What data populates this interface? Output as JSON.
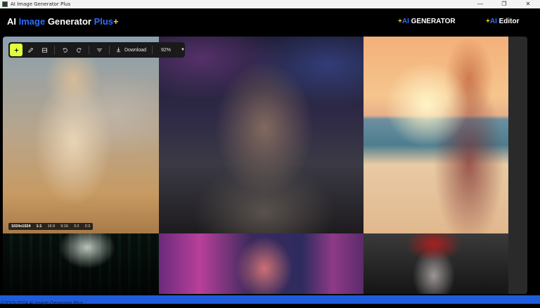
{
  "window": {
    "title": "AI Image Generator Plus",
    "controls": [
      "—",
      "❐",
      "✕"
    ]
  },
  "header": {
    "brand": {
      "part1": "AI ",
      "part2": "Image",
      "part3": " Generator ",
      "part4": "Plus",
      "star": "+"
    },
    "nav": [
      {
        "star": "+",
        "ai": "AI",
        "label": " GENERATOR"
      },
      {
        "star": "+",
        "ai": "AI",
        "label": " Editor"
      }
    ]
  },
  "toolbar": {
    "download_label": "Download",
    "zoom": "92%",
    "icons": [
      "magic-icon",
      "pencil-icon",
      "crop-icon",
      "undo-icon",
      "redo-icon",
      "filter-icon",
      "download-icon",
      "chevron-down-icon"
    ]
  },
  "ratios": {
    "size": "1024x1024",
    "options": [
      "1:1",
      "16:9",
      "9:16",
      "3:2",
      "2:3"
    ],
    "selected": "1:1"
  },
  "footer": {
    "text": "©2023-2024 AI Image Generator Plus"
  },
  "colors": {
    "accent_blue": "#2f6dff",
    "star_yellow": "#ffd21f",
    "active_tool": "#e2ff3c",
    "footer": "#1e5cdc"
  }
}
